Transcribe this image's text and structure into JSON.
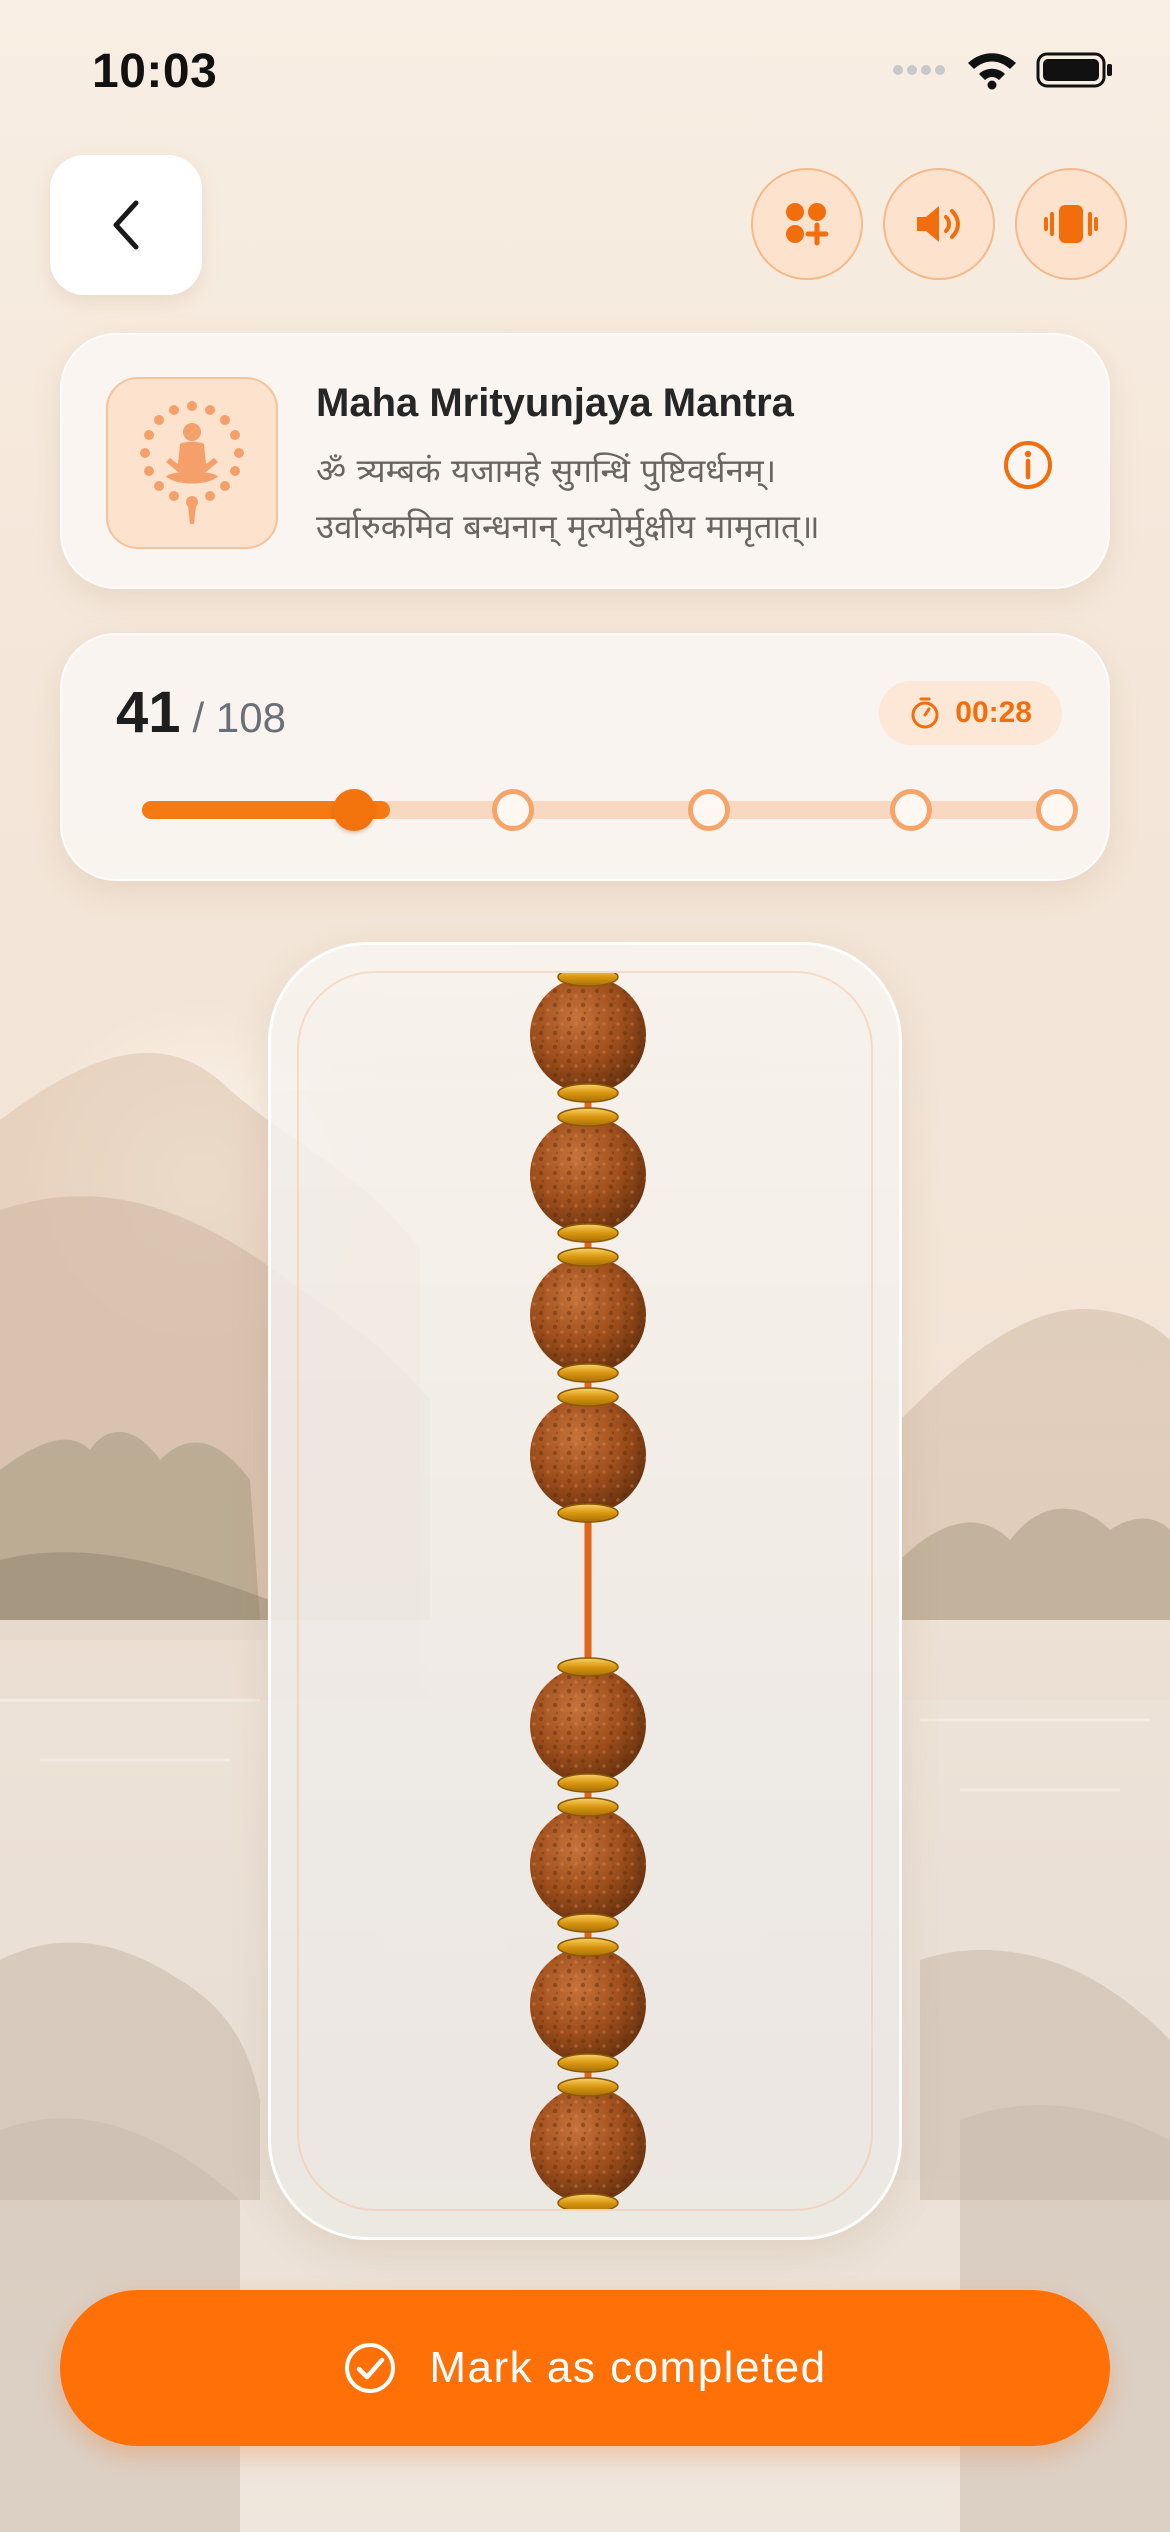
{
  "status_bar": {
    "time": "10:03"
  },
  "header": {
    "actions": [
      {
        "icon": "malas-add-icon"
      },
      {
        "icon": "sound-icon"
      },
      {
        "icon": "vibrate-icon"
      }
    ]
  },
  "mantra": {
    "title": "Maha Mrityunjaya Mantra",
    "line1": "ॐ त्र्यम्बकं यजामहे सुगन्धिं पुष्टिवर्धनम्।",
    "line2": "उर्वारुकमिव बन्धनान् मृत्योर्मुक्षीय मामृतात्॥"
  },
  "progress": {
    "current": "41",
    "total": "/ 108",
    "current_value": 41,
    "total_value": 108,
    "filled_fraction": 0.232,
    "milestones": [
      0.405,
      0.62,
      0.84,
      1.0
    ],
    "timer": "00:28"
  },
  "mala": {
    "beads_above": 4,
    "beads_below": 4
  },
  "complete_button": {
    "label": "Mark as completed"
  },
  "colors": {
    "accent": "#FF7006",
    "accent_soft": "#FDE3CD",
    "bead": "#A8531C",
    "gold": "#E4A51A"
  }
}
